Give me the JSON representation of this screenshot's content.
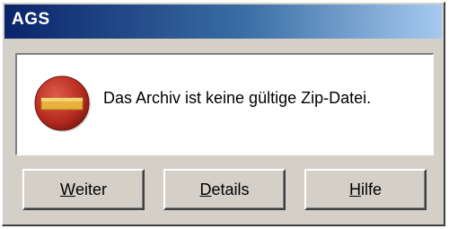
{
  "window": {
    "title": "AGS",
    "titlebar_colors": [
      "#0a246a",
      "#a6caf0"
    ]
  },
  "message": {
    "icon": "error-stop-icon",
    "text": "Das Archiv ist keine gültige Zip-Datei."
  },
  "buttons": [
    {
      "mnemonic": "W",
      "rest": "eiter"
    },
    {
      "mnemonic": "D",
      "rest": "etails"
    },
    {
      "mnemonic": "H",
      "rest": "ilfe"
    }
  ]
}
